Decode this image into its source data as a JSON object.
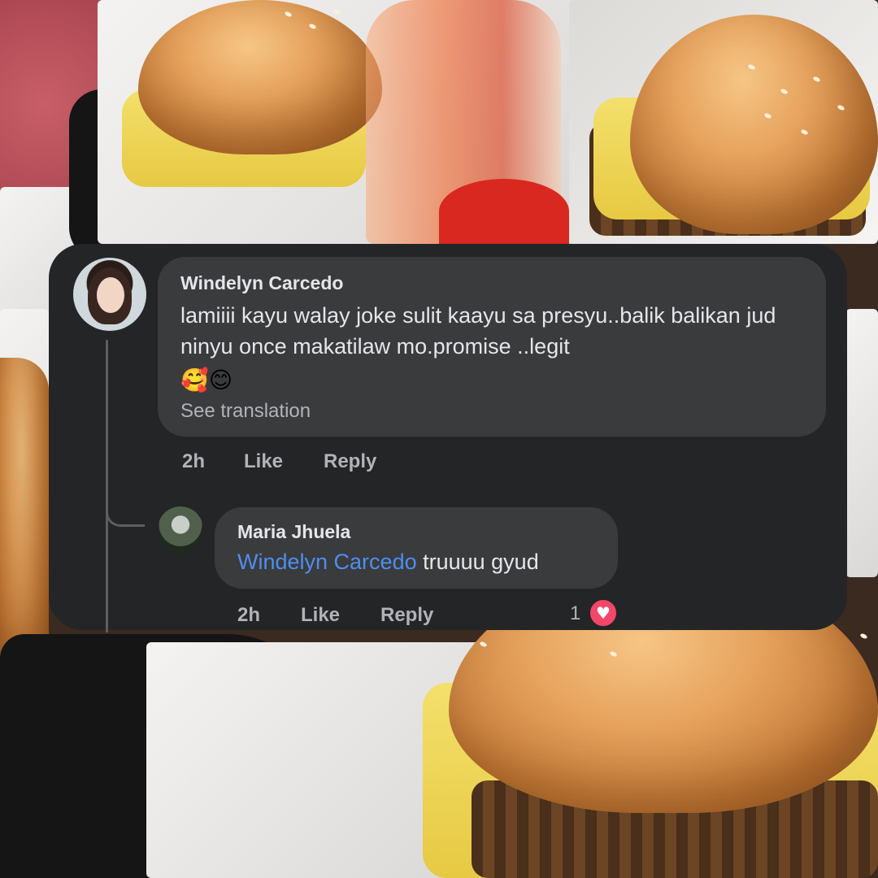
{
  "comment": {
    "author": "Windelyn Carcedo",
    "text": "lamiiii kayu walay joke sulit kaayu sa presyu..balik balikan jud ninyu once makatilaw mo.promise ..legit",
    "emojis": "🥰😊",
    "see_translation": "See translation",
    "time": "2h",
    "like_label": "Like",
    "reply_label": "Reply"
  },
  "reply": {
    "author": "Maria Jhuela",
    "mention": "Windelyn Carcedo",
    "text": " truuuu gyud",
    "time": "2h",
    "like_label": "Like",
    "reply_label": "Reply",
    "reaction_count": "1",
    "reaction_icon": "heart-icon"
  },
  "colors": {
    "card_bg": "#242526",
    "bubble_bg": "#3a3b3c",
    "mention": "#4e8ef0",
    "heart": "#f2476a"
  }
}
